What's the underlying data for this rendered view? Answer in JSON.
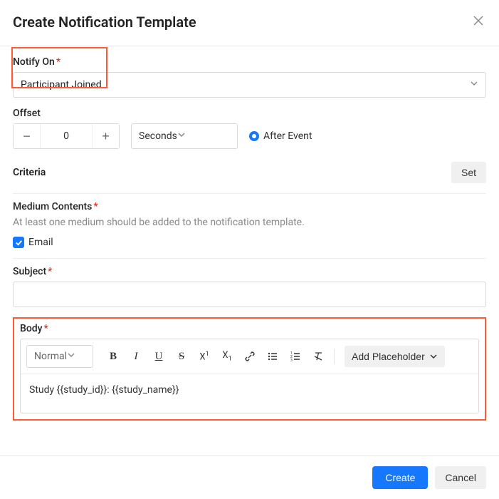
{
  "dialog": {
    "title": "Create Notification Template"
  },
  "notifyOn": {
    "label": "Notify On",
    "value": "Participant Joined"
  },
  "offset": {
    "label": "Offset",
    "value": "0",
    "unit": "Seconds",
    "timing_label": "After Event"
  },
  "criteria": {
    "label": "Criteria",
    "set_label": "Set"
  },
  "mediumContents": {
    "label": "Medium Contents",
    "helper": "At least one medium should be added to the notification template."
  },
  "email": {
    "label": "Email"
  },
  "subject": {
    "label": "Subject",
    "value": ""
  },
  "body": {
    "label": "Body",
    "format": "Normal",
    "placeholder_btn": "Add Placeholder",
    "content": "Study {{study_id}}: {{study_name}}"
  },
  "footer": {
    "create": "Create",
    "cancel": "Cancel"
  }
}
